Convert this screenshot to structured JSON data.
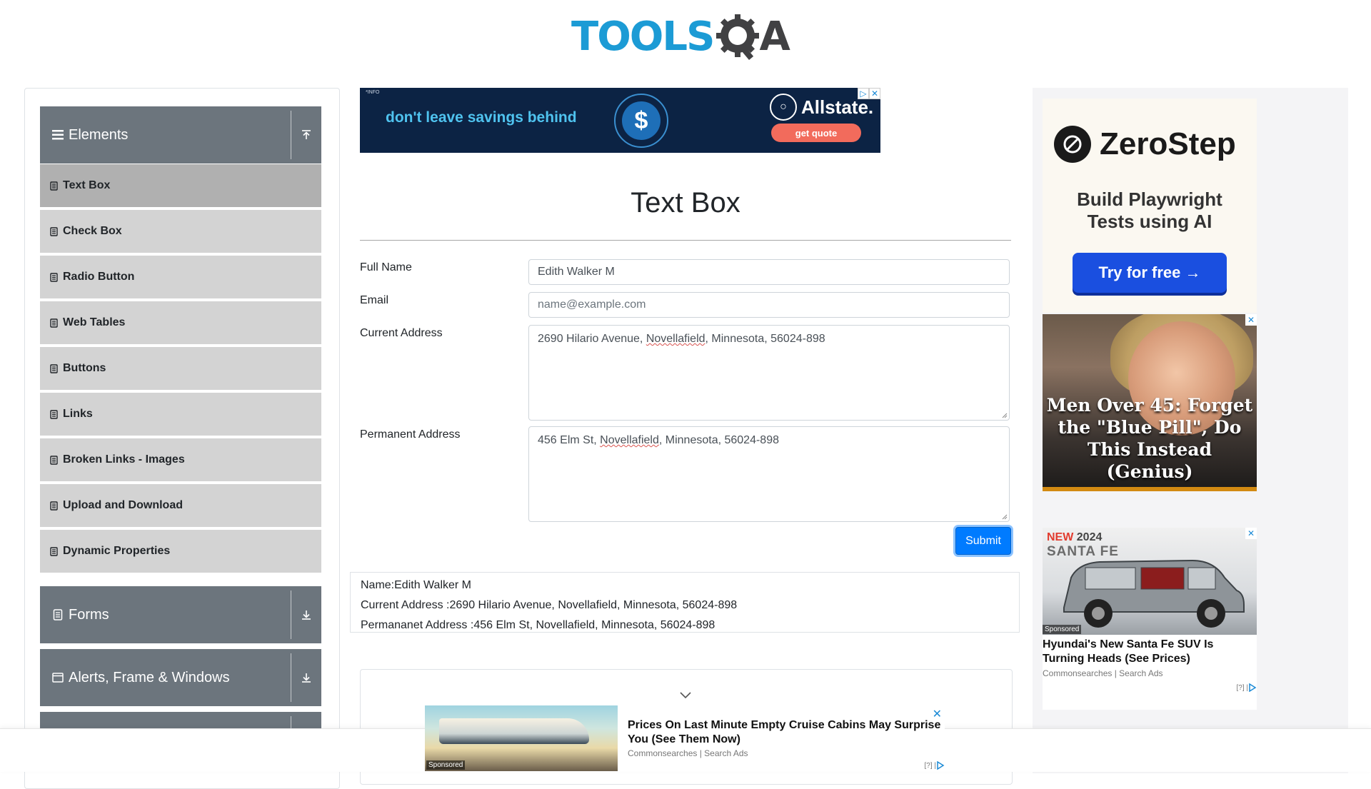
{
  "header": {
    "logo_text": "TOOLS",
    "logo_suffix": "A"
  },
  "sidebar": {
    "groups": [
      {
        "label": "Elements"
      },
      {
        "label": "Forms"
      },
      {
        "label": "Alerts, Frame & Windows"
      }
    ],
    "items": [
      {
        "label": "Text Box"
      },
      {
        "label": "Check Box"
      },
      {
        "label": "Radio Button"
      },
      {
        "label": "Web Tables"
      },
      {
        "label": "Buttons"
      },
      {
        "label": "Links"
      },
      {
        "label": "Broken Links - Images"
      },
      {
        "label": "Upload and Download"
      },
      {
        "label": "Dynamic Properties"
      }
    ]
  },
  "top_ad": {
    "info": "*INFO",
    "slogan": "don't leave savings behind",
    "brand": "Allstate.",
    "cta": "get quote"
  },
  "main": {
    "title": "Text Box",
    "form": {
      "full_name_label": "Full Name",
      "full_name_value": "Edith Walker M",
      "email_label": "Email",
      "email_placeholder": "name@example.com",
      "current_address_label": "Current Address",
      "current_address": {
        "pre": "2690 Hilario Avenue, ",
        "marked": "Novellafield",
        "post": ", Minnesota, 56024-898"
      },
      "permanent_address_label": "Permanent Address",
      "permanent_address": {
        "pre": "456 Elm St, ",
        "marked": "Novellafield",
        "post": ", Minnesota, 56024-898"
      },
      "submit_label": "Submit"
    },
    "output": {
      "name": "Name:Edith Walker M",
      "current": "Current Address :2690 Hilario Avenue, Novellafield, Minnesota, 56024-898",
      "permanent": "Permananet Address :456 Elm St, Novellafield, Minnesota, 56024-898"
    }
  },
  "right_ads": {
    "zerostep": {
      "brand": "ZeroStep",
      "tagline_1": "Build Playwright",
      "tagline_2": "Tests using AI",
      "cta": "Try for free →"
    },
    "pill": {
      "text": "Men Over 45: Forget the \"Blue Pill\", Do This Instead (Genius)"
    },
    "car": {
      "badge_new": "NEW",
      "badge_year": "2024",
      "model": "SANTA FE",
      "sponsored": "Sponsored",
      "headline": "Hyundai's New Santa Fe SUV Is Turning Heads (See Prices)",
      "source": "Commonsearches | Search Ads",
      "adchoice": "[?] |"
    }
  },
  "sticky_ad": {
    "sponsored": "Sponsored",
    "headline": "Prices On Last Minute Empty Cruise Cabins May Surprise You (See Them Now)",
    "source": "Commonsearches | Search Ads",
    "adchoice": "[?] |"
  },
  "colors": {
    "accent": "#007bff",
    "logo_blue": "#1c9bd5",
    "sidebar_header": "#6c757d",
    "sidebar_item": "#d3d3d3"
  }
}
